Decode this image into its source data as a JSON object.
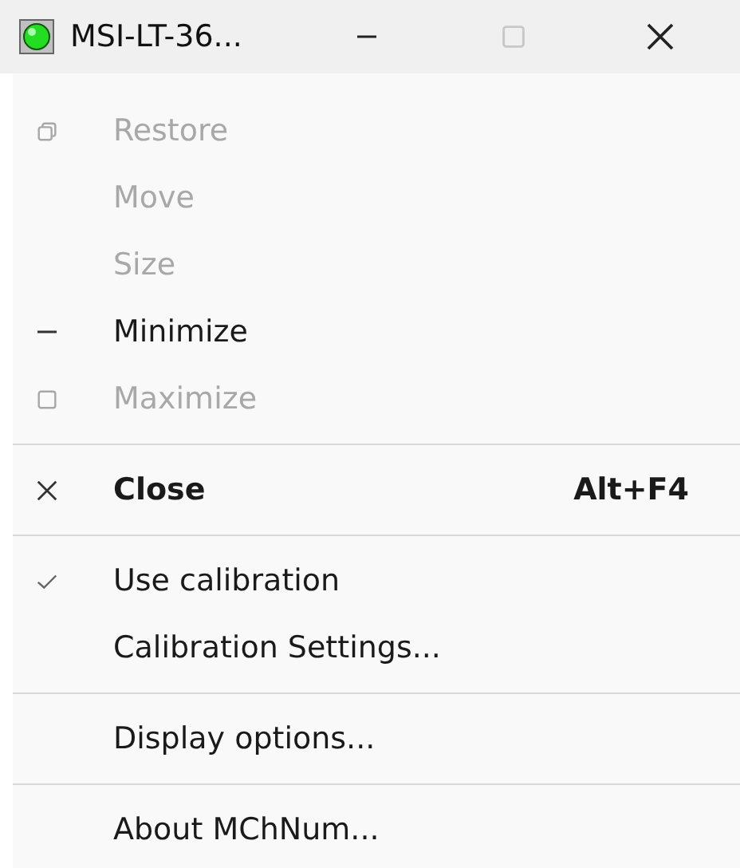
{
  "window": {
    "title": "MSI-LT-36...",
    "buttons": [
      {
        "kind": "minimize",
        "disabled": false
      },
      {
        "kind": "maximize",
        "disabled": true
      },
      {
        "kind": "close",
        "disabled": false
      }
    ]
  },
  "menu": {
    "sections": [
      [
        {
          "kind": "restore",
          "label": "Restore",
          "disabled": true
        },
        {
          "kind": "plain",
          "label": "Move",
          "disabled": true
        },
        {
          "kind": "plain",
          "label": "Size",
          "disabled": true
        },
        {
          "kind": "minimize",
          "label": "Minimize",
          "disabled": false
        },
        {
          "kind": "maximize",
          "label": "Maximize",
          "disabled": true
        }
      ],
      [
        {
          "kind": "close",
          "label": "Close",
          "shortcut": "Alt+F4",
          "disabled": false,
          "default": true
        }
      ],
      [
        {
          "kind": "plain",
          "label": "Use calibration",
          "disabled": false,
          "checked": true
        },
        {
          "kind": "plain",
          "label": "Calibration Settings...",
          "disabled": false,
          "checked": false
        }
      ],
      [
        {
          "kind": "plain",
          "label": "Display options...",
          "disabled": false
        }
      ],
      [
        {
          "kind": "plain",
          "label": "About MChNum...",
          "disabled": false
        }
      ]
    ]
  }
}
